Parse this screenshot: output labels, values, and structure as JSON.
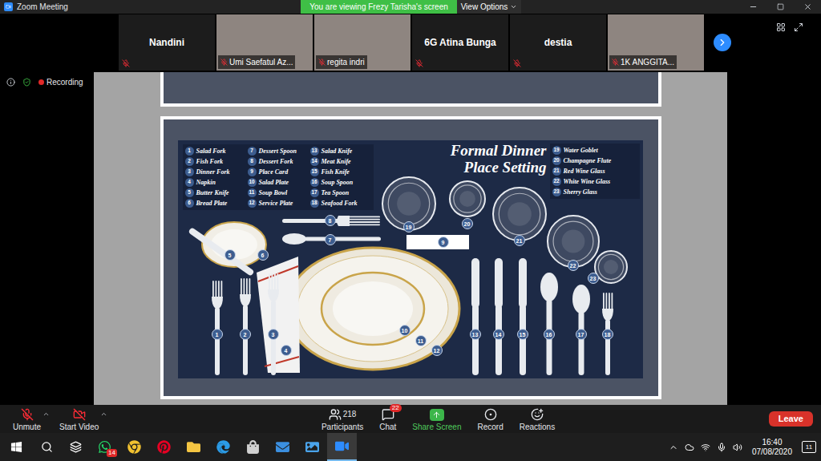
{
  "window": {
    "title": "Zoom Meeting"
  },
  "banner": {
    "text": "You are viewing Frezy Tarisha's screen",
    "options": "View Options"
  },
  "participants": [
    {
      "name": "Nandini",
      "video": false,
      "muted": true
    },
    {
      "name": "Umi Saefatul Az...",
      "video": true,
      "muted": true
    },
    {
      "name": "regita indri",
      "video": true,
      "muted": true
    },
    {
      "name": "6G Atina Bunga",
      "video": false,
      "muted": true
    },
    {
      "name": "destia",
      "video": false,
      "muted": true
    },
    {
      "name": "1K ANGGITA...",
      "video": true,
      "muted": true
    }
  ],
  "recording": {
    "label": "Recording",
    "on": true
  },
  "slide": {
    "title": [
      "Formal Dinner",
      "Place Setting"
    ],
    "legend": [
      [
        {
          "number": "1",
          "name": "Salad Fork"
        },
        {
          "number": "2",
          "name": "Fish Fork"
        },
        {
          "number": "3",
          "name": "Dinner Fork"
        },
        {
          "number": "4",
          "name": "Napkin"
        },
        {
          "number": "5",
          "name": "Butter Knife"
        },
        {
          "number": "6",
          "name": "Bread Plate"
        }
      ],
      [
        {
          "number": "7",
          "name": "Dessert Spoon"
        },
        {
          "number": "8",
          "name": "Dessert Fork"
        },
        {
          "number": "9",
          "name": "Place Card"
        },
        {
          "number": "10",
          "name": "Salad Plate"
        },
        {
          "number": "11",
          "name": "Soup Bowl"
        },
        {
          "number": "12",
          "name": "Service Plate"
        }
      ],
      [
        {
          "number": "13",
          "name": "Salad Knife"
        },
        {
          "number": "14",
          "name": "Meat Knife"
        },
        {
          "number": "15",
          "name": "Fish Knife"
        },
        {
          "number": "16",
          "name": "Soup Spoon"
        },
        {
          "number": "17",
          "name": "Tea Spoon"
        },
        {
          "number": "18",
          "name": "Seafood Fork"
        }
      ],
      [
        {
          "number": "19",
          "name": "Water Goblet"
        },
        {
          "number": "20",
          "name": "Champagne Flute"
        },
        {
          "number": "21",
          "name": "Red Wine Glass"
        },
        {
          "number": "22",
          "name": "White Wine Glass"
        },
        {
          "number": "23",
          "name": "Sherry Glass"
        }
      ]
    ]
  },
  "toolbar": {
    "controls": [
      {
        "label": "Unmute",
        "kind": "mic",
        "off": true
      },
      {
        "label": "Start Video",
        "kind": "video",
        "off": true
      }
    ],
    "actions": [
      {
        "label": "Participants",
        "kind": "participants",
        "count": "218"
      },
      {
        "label": "Chat",
        "kind": "chat",
        "badge": "22"
      },
      {
        "label": "Share Screen",
        "kind": "share"
      },
      {
        "label": "Record",
        "kind": "record"
      },
      {
        "label": "Reactions",
        "kind": "reactions"
      }
    ],
    "leave": "Leave"
  },
  "taskbar": {
    "apps": [
      {
        "kind": "whatsapp",
        "badge": "14",
        "active": false
      },
      {
        "kind": "chrome",
        "active": false
      },
      {
        "kind": "pinterest",
        "active": false
      },
      {
        "kind": "explorer",
        "active": false
      },
      {
        "kind": "edge",
        "active": false
      },
      {
        "kind": "store",
        "active": false
      },
      {
        "kind": "mail",
        "active": false
      },
      {
        "kind": "photos",
        "active": false
      },
      {
        "kind": "zoom",
        "active": true
      }
    ],
    "time": "16:40",
    "date": "07/08/2020",
    "notifications": "11"
  }
}
